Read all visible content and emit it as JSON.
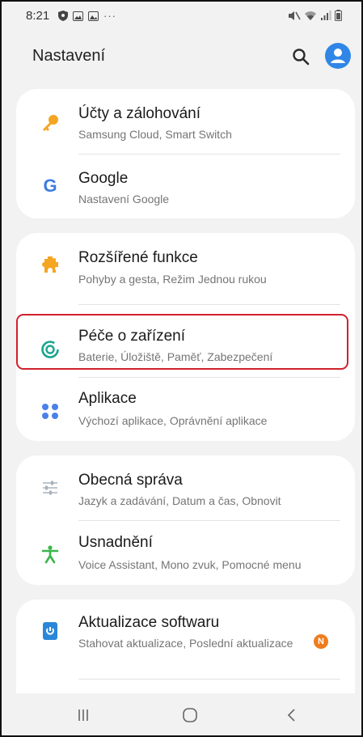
{
  "status_bar": {
    "time": "8:21",
    "more_indicator": "···"
  },
  "header": {
    "title": "Nastavení",
    "search_icon": "search-icon",
    "account_icon": "account-icon"
  },
  "settings": {
    "accounts": {
      "title": "Účty a zálohování",
      "subtitle": "Samsung Cloud, Smart Switch",
      "icon": "key-icon",
      "icon_color": "#f4a521"
    },
    "google": {
      "title": "Google",
      "subtitle": "Nastavení Google",
      "icon": "google-g-icon",
      "icon_color": "#3d7be0"
    },
    "advanced": {
      "title": "Rozšířené funkce",
      "subtitle": "Pohyby a gesta, Režim Jednou rukou",
      "icon": "puzzle-gear-icon",
      "icon_color": "#f4a521"
    },
    "device_care": {
      "title": "Péče o zařízení",
      "subtitle": "Baterie, Úložiště, Paměť, Zabezpečení",
      "icon": "device-care-icon",
      "icon_color": "#18a58d"
    },
    "apps": {
      "title": "Aplikace",
      "subtitle": "Výchozí aplikace, Oprávnění aplikace",
      "icon": "apps-dots-icon",
      "icon_color": "#4a80e8"
    },
    "general": {
      "title": "Obecná správa",
      "subtitle": "Jazyk a zadávání, Datum a čas, Obnovit",
      "icon": "sliders-icon",
      "icon_color": "#7d8c9c"
    },
    "accessibility": {
      "title": "Usnadnění",
      "subtitle": "Voice Assistant, Mono zvuk, Pomocné menu",
      "icon": "accessibility-icon",
      "icon_color": "#3bb54a"
    },
    "software_update": {
      "title": "Aktualizace softwaru",
      "subtitle": "Stahovat aktualizace, Poslední aktualizace",
      "icon": "software-update-icon",
      "icon_color": "#2a86d8",
      "badge": "N",
      "badge_color": "#ef7c1c"
    }
  },
  "highlight_color": "#d0212c"
}
